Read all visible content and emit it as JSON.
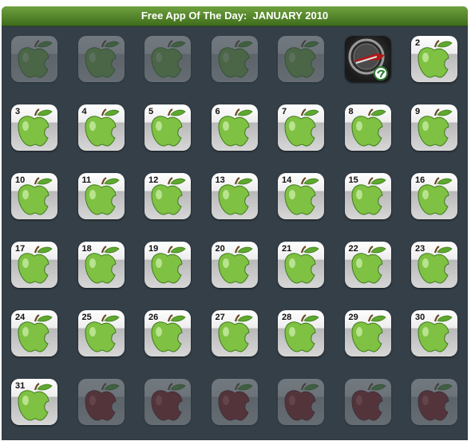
{
  "header": {
    "title": "Free App Of The Day:  JANUARY 2010"
  },
  "colors": {
    "header_green": "#4f8a2a",
    "panel": "#343f48",
    "apple_green": "#7fc142",
    "apple_red": "#a01e1e"
  },
  "calendar": {
    "month": "JANUARY 2010",
    "cells": [
      {
        "day": "",
        "state": "inactive",
        "icon": "green-apple-icon"
      },
      {
        "day": "",
        "state": "inactive",
        "icon": "green-apple-icon"
      },
      {
        "day": "",
        "state": "inactive",
        "icon": "green-apple-icon"
      },
      {
        "day": "",
        "state": "inactive",
        "icon": "green-apple-icon"
      },
      {
        "day": "",
        "state": "inactive",
        "icon": "green-apple-icon"
      },
      {
        "day": "",
        "state": "featured",
        "icon": "featured-app-icon"
      },
      {
        "day": "2",
        "state": "active",
        "icon": "green-apple-icon"
      },
      {
        "day": "3",
        "state": "active",
        "icon": "green-apple-icon"
      },
      {
        "day": "4",
        "state": "active",
        "icon": "green-apple-icon"
      },
      {
        "day": "5",
        "state": "active",
        "icon": "green-apple-icon"
      },
      {
        "day": "6",
        "state": "active",
        "icon": "green-apple-icon"
      },
      {
        "day": "7",
        "state": "active",
        "icon": "green-apple-icon"
      },
      {
        "day": "8",
        "state": "active",
        "icon": "green-apple-icon"
      },
      {
        "day": "9",
        "state": "active",
        "icon": "green-apple-icon"
      },
      {
        "day": "10",
        "state": "active",
        "icon": "green-apple-icon"
      },
      {
        "day": "11",
        "state": "active",
        "icon": "green-apple-icon"
      },
      {
        "day": "12",
        "state": "active",
        "icon": "green-apple-icon"
      },
      {
        "day": "13",
        "state": "active",
        "icon": "green-apple-icon"
      },
      {
        "day": "14",
        "state": "active",
        "icon": "green-apple-icon"
      },
      {
        "day": "15",
        "state": "active",
        "icon": "green-apple-icon"
      },
      {
        "day": "16",
        "state": "active",
        "icon": "green-apple-icon"
      },
      {
        "day": "17",
        "state": "active",
        "icon": "green-apple-icon"
      },
      {
        "day": "18",
        "state": "active",
        "icon": "green-apple-icon"
      },
      {
        "day": "19",
        "state": "active",
        "icon": "green-apple-icon"
      },
      {
        "day": "20",
        "state": "active",
        "icon": "green-apple-icon"
      },
      {
        "day": "21",
        "state": "active",
        "icon": "green-apple-icon"
      },
      {
        "day": "22",
        "state": "active",
        "icon": "green-apple-icon"
      },
      {
        "day": "23",
        "state": "active",
        "icon": "green-apple-icon"
      },
      {
        "day": "24",
        "state": "active",
        "icon": "green-apple-icon"
      },
      {
        "day": "25",
        "state": "active",
        "icon": "green-apple-icon"
      },
      {
        "day": "26",
        "state": "active",
        "icon": "green-apple-icon"
      },
      {
        "day": "27",
        "state": "active",
        "icon": "green-apple-icon"
      },
      {
        "day": "28",
        "state": "active",
        "icon": "green-apple-icon"
      },
      {
        "day": "29",
        "state": "active",
        "icon": "green-apple-icon"
      },
      {
        "day": "30",
        "state": "active",
        "icon": "green-apple-icon"
      },
      {
        "day": "31",
        "state": "active",
        "icon": "green-apple-icon"
      },
      {
        "day": "",
        "state": "inactive",
        "icon": "red-apple-icon"
      },
      {
        "day": "",
        "state": "inactive",
        "icon": "red-apple-icon"
      },
      {
        "day": "",
        "state": "inactive",
        "icon": "red-apple-icon"
      },
      {
        "day": "",
        "state": "inactive",
        "icon": "red-apple-icon"
      },
      {
        "day": "",
        "state": "inactive",
        "icon": "red-apple-icon"
      },
      {
        "day": "",
        "state": "inactive",
        "icon": "red-apple-icon"
      }
    ]
  }
}
